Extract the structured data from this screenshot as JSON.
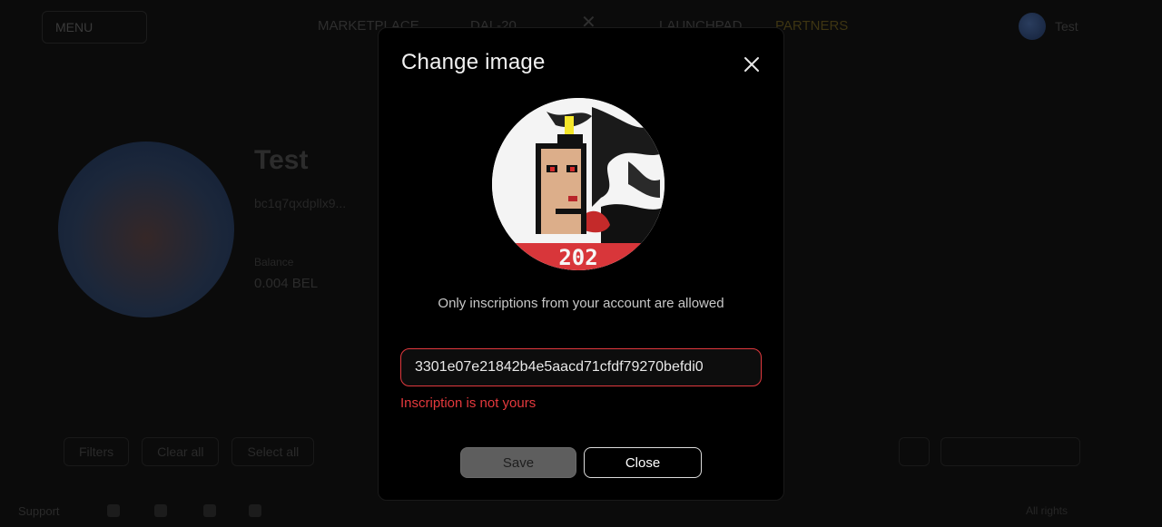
{
  "background": {
    "top_nav": {
      "menu_button": "MENU",
      "links": [
        "MARKETPLACE",
        "DAL-20",
        "LAUNCHPAD",
        "PARTNERS"
      ],
      "user_name": "Test"
    },
    "profile": {
      "name": "Test",
      "address": "bc1q7qxdpllx9...",
      "balance_label": "Balance",
      "balance_value": "0.004 BEL"
    },
    "filters": [
      "Filters",
      "Clear all",
      "Select all"
    ],
    "footer": {
      "support_label": "Support",
      "right_text": "All rights"
    }
  },
  "modal": {
    "title": "Change image",
    "hint": "Only inscriptions from your account are allowed",
    "inscription_input": {
      "value": "3301e07e21842b4e5aacd71cfdf79270befdi0",
      "placeholder": "Inscription ID"
    },
    "error_text": "Inscription is not yours",
    "save_label": "Save",
    "close_label": "Close",
    "preview_badge_text": "202"
  },
  "colors": {
    "error": "#e5393d",
    "modal_bg": "#000000",
    "save_disabled_bg": "#5e5e5e",
    "preview_band": "#d8363a"
  },
  "icons": {
    "close": "close-icon"
  }
}
